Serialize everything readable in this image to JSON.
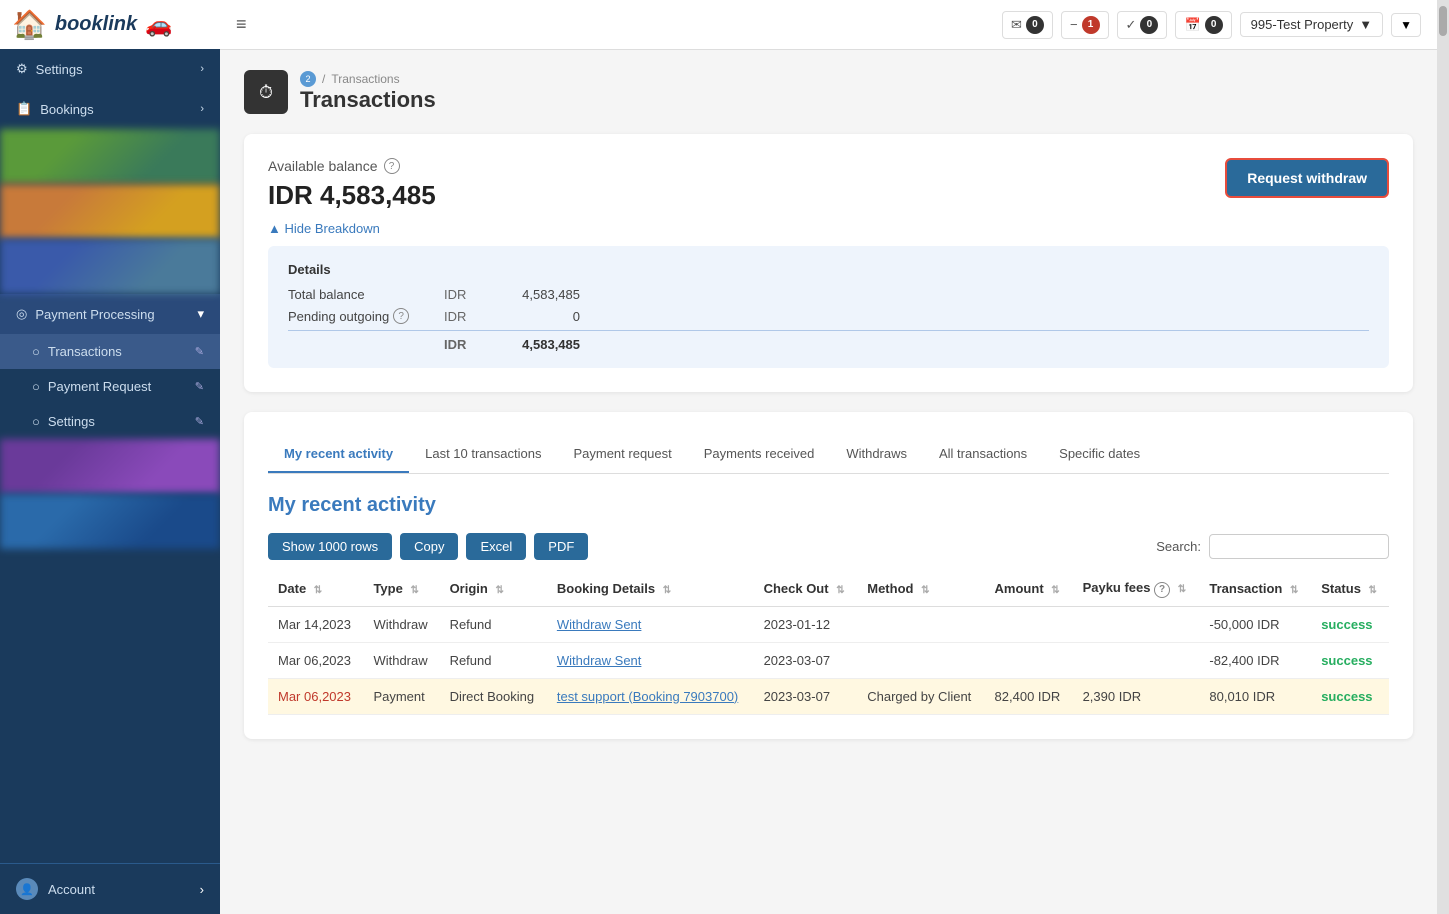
{
  "app": {
    "logo_text": "booklink",
    "hamburger_icon": "≡"
  },
  "topnav": {
    "notifications": [
      {
        "icon": "✉",
        "count": "0",
        "count_style": "dark"
      },
      {
        "icon": "−",
        "count": "1",
        "count_style": "red"
      },
      {
        "icon": "✓",
        "count": "0",
        "count_style": "dark"
      },
      {
        "icon": "📅",
        "count": "0",
        "count_style": "dark"
      }
    ],
    "property": "995-Test Property",
    "dropdown_arrow": "▼"
  },
  "sidebar": {
    "items": [
      {
        "label": "Settings",
        "arrow": "›",
        "icon": "⚙"
      },
      {
        "label": "Bookings",
        "arrow": "›",
        "icon": "📋"
      }
    ],
    "payment_processing": {
      "label": "Payment Processing",
      "icon": "◎",
      "arrow": "▾"
    },
    "sub_items": [
      {
        "label": "Transactions",
        "icon": "○",
        "active": true
      },
      {
        "label": "Payment Request",
        "icon": "○",
        "active": false
      },
      {
        "label": "Settings",
        "icon": "○",
        "active": false
      }
    ],
    "account": {
      "label": "Account",
      "icon": "👤",
      "arrow": "›"
    }
  },
  "breadcrumb": {
    "icon_text": "2",
    "path": "Transactions",
    "title": "Transactions"
  },
  "balance": {
    "label": "Available balance",
    "amount": "IDR 4,583,485",
    "hide_breakdown_label": "▲ Hide Breakdown",
    "request_withdraw_label": "Request withdraw",
    "breakdown": {
      "title": "Details",
      "rows": [
        {
          "label": "Total balance",
          "currency": "IDR",
          "amount": "4,583,485"
        },
        {
          "label": "Pending outgoing",
          "currency": "IDR",
          "amount": "0",
          "has_info": true
        }
      ],
      "total_currency": "IDR",
      "total_amount": "4,583,485"
    }
  },
  "activity": {
    "tabs": [
      {
        "label": "My recent activity",
        "active": true
      },
      {
        "label": "Last 10 transactions",
        "active": false
      },
      {
        "label": "Payment request",
        "active": false
      },
      {
        "label": "Payments received",
        "active": false
      },
      {
        "label": "Withdraws",
        "active": false
      },
      {
        "label": "All transactions",
        "active": false
      },
      {
        "label": "Specific dates",
        "active": false
      }
    ],
    "title": "My recent activity",
    "toolbar": {
      "show1000": "Show 1000 rows",
      "copy": "Copy",
      "excel": "Excel",
      "pdf": "PDF"
    },
    "search_label": "Search:",
    "search_placeholder": "",
    "columns": [
      {
        "label": "Date",
        "sortable": true
      },
      {
        "label": "Type",
        "sortable": true
      },
      {
        "label": "Origin",
        "sortable": true
      },
      {
        "label": "Booking Details",
        "sortable": true
      },
      {
        "label": "Check Out",
        "sortable": true
      },
      {
        "label": "Method",
        "sortable": true
      },
      {
        "label": "Amount",
        "sortable": true
      },
      {
        "label": "Payku fees",
        "sortable": true,
        "has_info": true
      },
      {
        "label": "Transaction",
        "sortable": true
      },
      {
        "label": "Status",
        "sortable": true
      }
    ],
    "rows": [
      {
        "date": "Mar 14,2023",
        "type": "Withdraw",
        "origin": "Refund",
        "booking_details": "Withdraw Sent",
        "booking_link": true,
        "check_out": "2023-01-12",
        "method": "",
        "amount": "",
        "payku_fees": "",
        "transaction": "-50,000 IDR",
        "status": "success",
        "highlight": false
      },
      {
        "date": "Mar 06,2023",
        "type": "Withdraw",
        "origin": "Refund",
        "booking_details": "Withdraw Sent",
        "booking_link": true,
        "check_out": "2023-03-07",
        "method": "",
        "amount": "",
        "payku_fees": "",
        "transaction": "-82,400 IDR",
        "status": "success",
        "highlight": false
      },
      {
        "date": "Mar 06,2023",
        "type": "Payment",
        "origin": "Direct Booking",
        "booking_details": "test support (Booking 7903700)",
        "booking_link": true,
        "check_out": "2023-03-07",
        "method": "Charged by Client",
        "amount": "82,400 IDR",
        "payku_fees": "2,390 IDR",
        "transaction": "80,010 IDR",
        "status": "success",
        "highlight": true
      }
    ]
  }
}
